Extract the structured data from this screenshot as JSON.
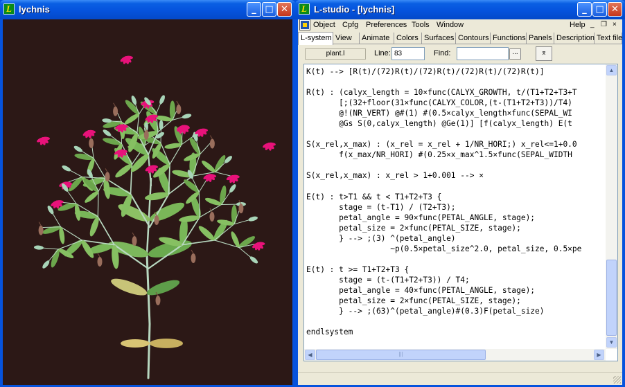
{
  "plant_window": {
    "title": "lychnis",
    "icon_letter": "L",
    "buttons": {
      "minimize": "_",
      "maximize": "□",
      "close": "✕"
    },
    "canvas_bg": "#2c1816"
  },
  "studio_window": {
    "title": "L-studio - [lychnis]",
    "icon_letter": "L",
    "buttons": {
      "minimize": "_",
      "maximize": "□",
      "close": "✕"
    },
    "menu": [
      "Object",
      "Cpfg",
      "Preferences",
      "Tools",
      "Window"
    ],
    "help": "Help",
    "mdi_buttons": [
      "_",
      "❐",
      "×"
    ],
    "tabs": [
      "L-system",
      "View",
      "Animate",
      "Colors",
      "Surfaces",
      "Contours",
      "Functions",
      "Panels",
      "Description",
      "Text file"
    ],
    "active_tab": "L-system",
    "toolbar": {
      "file": "plant.l",
      "line_label": "Line:",
      "line_value": "83",
      "find_label": "Find:",
      "find_value": "",
      "browse_label": "...",
      "tool_label": "⌆"
    },
    "code_lines": [
      "K(t) --> [R(t)/(72)R(t)/(72)R(t)/(72)R(t)/(72)R(t)]",
      "",
      "R(t) : (calyx_length = 10×func(CALYX_GROWTH, t/(T1+T2+T3+T",
      "       [;(32+floor(31×func(CALYX_COLOR,(t-(T1+T2+T3))/T4)",
      "       @!(NR_VERT) @#(1) #(0.5×calyx_length×func(SEPAL_WI",
      "       @Gs S(0,calyx_length) @Ge(1)] [f(calyx_length) E(t",
      "",
      "S(x_rel,x_max) : (x_rel = x_rel + 1/NR_HORI;) x_rel<=1+0.0",
      "       f(x_max/NR_HORI) #(0.25×x_max^1.5×func(SEPAL_WIDTH",
      "",
      "S(x_rel,x_max) : x_rel > 1+0.001 --> ×",
      "",
      "E(t) : t>T1 && t < T1+T2+T3 {",
      "       stage = (t-T1) / (T2+T3);",
      "       petal_angle = 90×func(PETAL_ANGLE, stage);",
      "       petal_size = 2×func(PETAL_SIZE, stage);",
      "       } --> ;(3) ^(petal_angle)",
      "                  ~p(0.5×petal_size^2.0, petal_size, 0.5×pe",
      "",
      "E(t) : t >= T1+T2+T3 {",
      "       stage = (t-(T1+T2+T3)) / T4;",
      "       petal_angle = 40×func(PETAL_ANGLE, stage);",
      "       petal_size = 2×func(PETAL_SIZE, stage);",
      "       } --> ;(63)^(petal_angle)#(0.3)F(petal_size)",
      "",
      "endlsystem",
      ""
    ]
  }
}
